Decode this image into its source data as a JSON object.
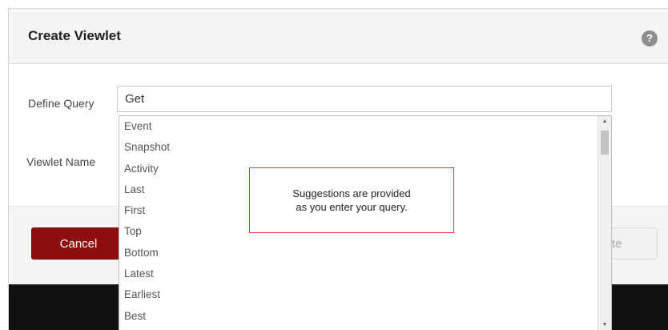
{
  "dialog": {
    "title": "Create Viewlet",
    "help_icon": "?"
  },
  "form": {
    "query_label": "Define Query",
    "query_value": "Get",
    "name_label": "Viewlet Name"
  },
  "suggestions": {
    "items": [
      "Event",
      "Snapshot",
      "Activity",
      "Last",
      "First",
      "Top",
      "Bottom",
      "Latest",
      "Earliest",
      "Best"
    ]
  },
  "callout": {
    "line1": "Suggestions are provided",
    "line2": "as you enter your query."
  },
  "buttons": {
    "cancel_label": "Cancel",
    "create_label_visible": "ate"
  },
  "colors": {
    "cancel_bg": "#8e0e0e",
    "callout_border": "#d83b3b"
  }
}
